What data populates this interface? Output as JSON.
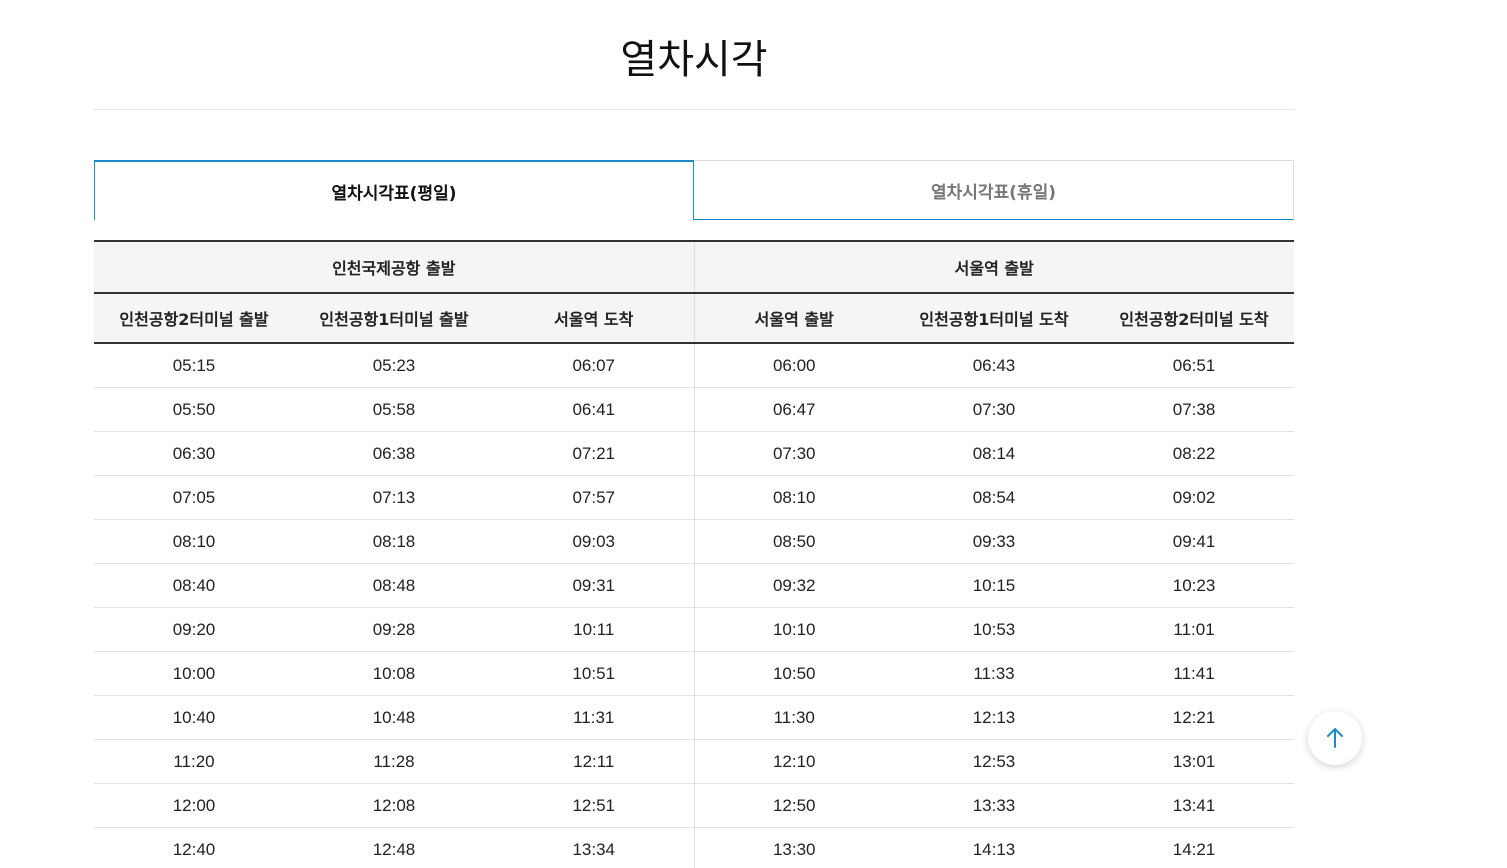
{
  "page": {
    "title": "열차시각"
  },
  "tabs": [
    {
      "label": "열차시각표(평일)",
      "active": true
    },
    {
      "label": "열차시각표(휴일)",
      "active": false
    }
  ],
  "table": {
    "groups": [
      "인천국제공항 출발",
      "서울역 출발"
    ],
    "columns": [
      "인천공항2터미널 출발",
      "인천공항1터미널 출발",
      "서울역 도착",
      "서울역 출발",
      "인천공항1터미널 도착",
      "인천공항2터미널 도착"
    ],
    "rows": [
      [
        "05:15",
        "05:23",
        "06:07",
        "06:00",
        "06:43",
        "06:51"
      ],
      [
        "05:50",
        "05:58",
        "06:41",
        "06:47",
        "07:30",
        "07:38"
      ],
      [
        "06:30",
        "06:38",
        "07:21",
        "07:30",
        "08:14",
        "08:22"
      ],
      [
        "07:05",
        "07:13",
        "07:57",
        "08:10",
        "08:54",
        "09:02"
      ],
      [
        "08:10",
        "08:18",
        "09:03",
        "08:50",
        "09:33",
        "09:41"
      ],
      [
        "08:40",
        "08:48",
        "09:31",
        "09:32",
        "10:15",
        "10:23"
      ],
      [
        "09:20",
        "09:28",
        "10:11",
        "10:10",
        "10:53",
        "11:01"
      ],
      [
        "10:00",
        "10:08",
        "10:51",
        "10:50",
        "11:33",
        "11:41"
      ],
      [
        "10:40",
        "10:48",
        "11:31",
        "11:30",
        "12:13",
        "12:21"
      ],
      [
        "11:20",
        "11:28",
        "12:11",
        "12:10",
        "12:53",
        "13:01"
      ],
      [
        "12:00",
        "12:08",
        "12:51",
        "12:50",
        "13:33",
        "13:41"
      ],
      [
        "12:40",
        "12:48",
        "13:34",
        "13:30",
        "14:13",
        "14:21"
      ]
    ]
  },
  "scroll_top": {
    "icon": "arrow-up-icon",
    "color": "#1e88c8"
  },
  "colors": {
    "accent": "#1e88c8",
    "header_bg": "#f4f5f7"
  }
}
